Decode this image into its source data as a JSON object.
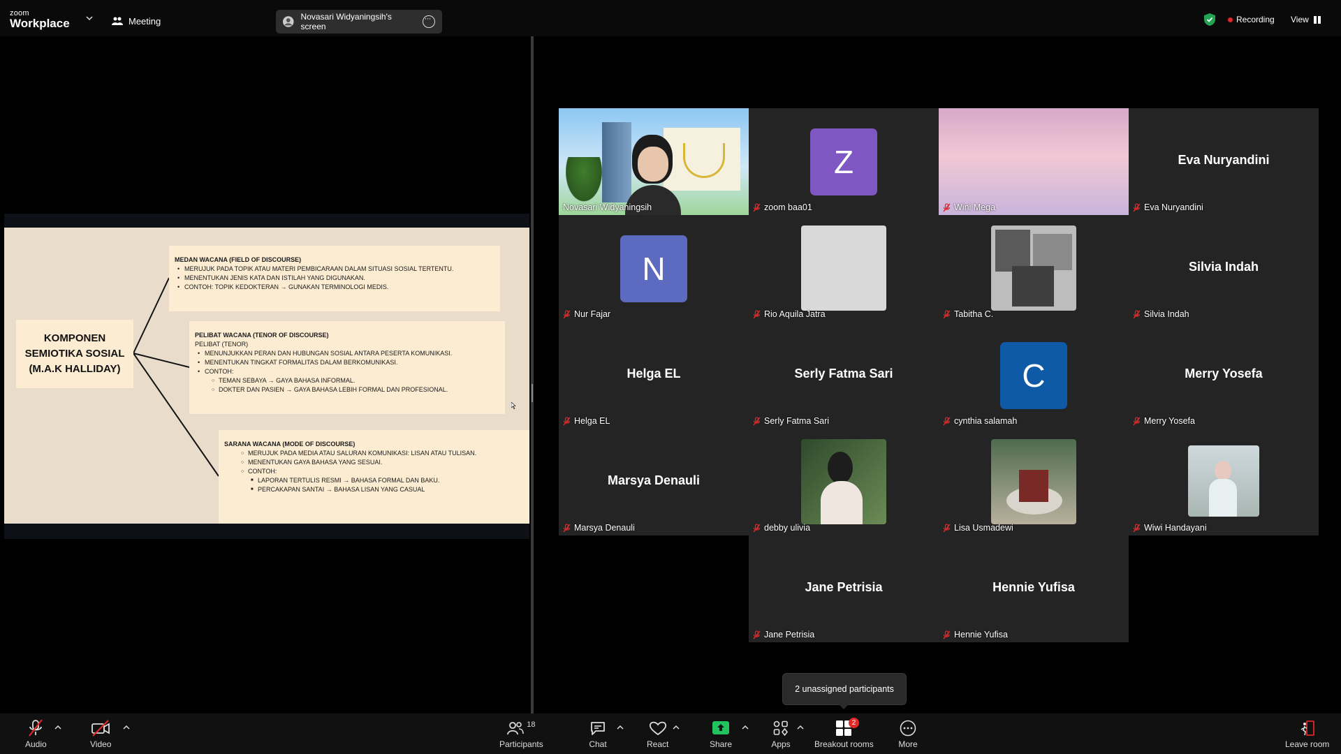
{
  "app": {
    "logo_small": "zoom",
    "logo_big": "Workplace"
  },
  "header": {
    "meeting_label": "Meeting",
    "share_label": "Novasari Widyaningsih's screen",
    "recording_label": "Recording",
    "view_label": "View"
  },
  "slide": {
    "main_title": [
      "KOMPONEN",
      "SEMIOTIKA SOSIAL",
      "(M.A.K HALLIDAY)"
    ],
    "medan": {
      "title": "MEDAN WACANA (FIELD OF DISCOURSE)",
      "items": [
        "MERUJUK PADA TOPIK ATAU MATERI PEMBICARAAN DALAM SITUASI SOSIAL TERTENTU.",
        "MENENTUKAN JENIS KATA DAN ISTILAH YANG DIGUNAKAN.",
        "CONTOH: TOPIK KEDOKTERAN → GUNAKAN TERMINOLOGI MEDIS."
      ]
    },
    "pelibat": {
      "title": "PELIBAT WACANA (TENOR OF DISCOURSE)",
      "subtitle": "PELIBAT (TENOR)",
      "items": [
        "MENUNJUKKAN PERAN DAN HUBUNGAN SOSIAL ANTARA PESERTA KOMUNIKASI.",
        "MENENTUKAN TINGKAT FORMALITAS DALAM BERKOMUNIKASI.",
        "CONTOH:"
      ],
      "examples": [
        "TEMAN SEBAYA → GAYA BAHASA INFORMAL.",
        "DOKTER DAN PASIEN → GAYA BAHASA LEBIH FORMAL DAN PROFESIONAL."
      ]
    },
    "sarana": {
      "title": "SARANA WACANA (MODE OF DISCOURSE)",
      "items": [
        "MERUJUK PADA MEDIA ATAU SALURAN KOMUNIKASI: LISAN ATAU TULISAN.",
        "MENENTUKAN GAYA BAHASA YANG SESUAI.",
        "CONTOH:"
      ],
      "examples": [
        "LAPORAN TERTULIS RESMI → BAHASA FORMAL DAN BAKU.",
        "PERCAKAPAN SANTAI → BAHASA LISAN YANG CASUAL"
      ]
    }
  },
  "participants": [
    {
      "name": "Novasari Widyaningsih",
      "type": "video",
      "active": true,
      "muted": false
    },
    {
      "name": "zoom baa01",
      "type": "letter",
      "letter": "Z",
      "color": "#7e57c2",
      "muted": true
    },
    {
      "name": "Wini Mega",
      "type": "sky",
      "muted": true
    },
    {
      "name": "Eva Nuryandini",
      "type": "text",
      "muted": true
    },
    {
      "name": "Nur Fajar",
      "type": "letter",
      "letter": "N",
      "color": "#5c6bc0",
      "muted": true
    },
    {
      "name": "Rio Aquila Jatra",
      "type": "blank",
      "muted": true
    },
    {
      "name": "Tabitha C.",
      "type": "collage",
      "muted": true
    },
    {
      "name": "Silvia Indah",
      "type": "text",
      "muted": true
    },
    {
      "name": "Helga EL",
      "type": "text",
      "muted": true
    },
    {
      "name": "Serly Fatma Sari",
      "type": "text",
      "muted": true
    },
    {
      "name": "cynthia salamah",
      "type": "letter",
      "letter": "C",
      "color": "#0e5aa7",
      "muted": true
    },
    {
      "name": "Merry Yosefa",
      "type": "text",
      "muted": true
    },
    {
      "name": "Marsya Denauli",
      "type": "text",
      "muted": true
    },
    {
      "name": "debby ulivia",
      "type": "photo-green",
      "muted": true
    },
    {
      "name": "Lisa Usmadewi",
      "type": "photo-cake",
      "muted": true
    },
    {
      "name": "Wiwi Handayani",
      "type": "photo-person",
      "muted": true
    },
    {
      "name": "Jane Petrisia",
      "type": "text",
      "muted": true
    },
    {
      "name": "Hennie Yufisa",
      "type": "text",
      "muted": true
    }
  ],
  "tooltip": "2 unassigned participants",
  "toolbar": {
    "audio": "Audio",
    "video": "Video",
    "participants": "Participants",
    "participants_count": "18",
    "chat": "Chat",
    "react": "React",
    "share": "Share",
    "apps": "Apps",
    "breakout": "Breakout rooms",
    "breakout_badge": "2",
    "more": "More",
    "leave": "Leave room"
  }
}
